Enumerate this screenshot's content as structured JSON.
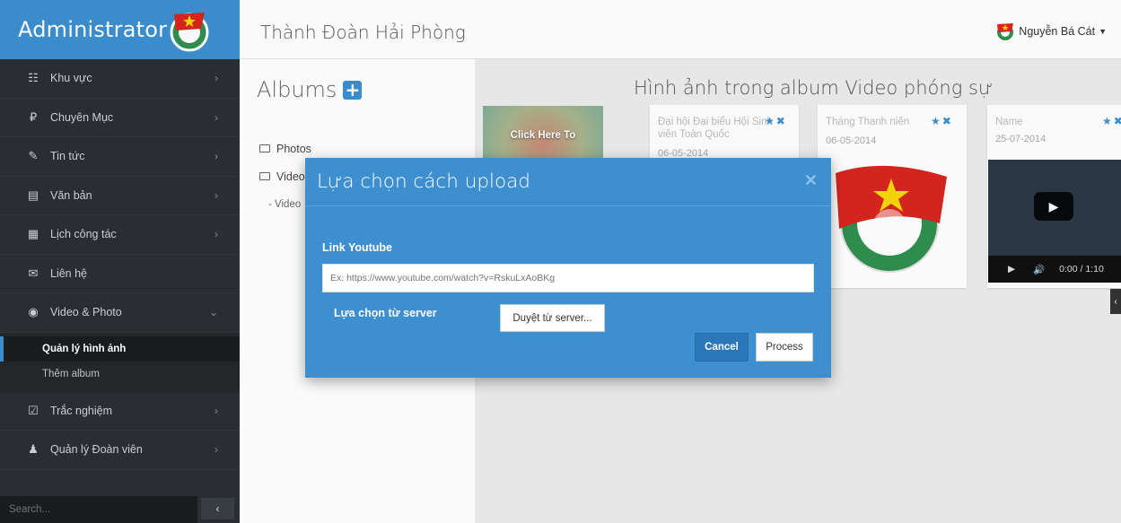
{
  "brand": {
    "title": "Administrator"
  },
  "header": {
    "site_title": "Thành Đoàn Hải Phòng",
    "user_name": "Nguyễn Bá Cát"
  },
  "sidebar": {
    "items": [
      {
        "label": "Khu vực",
        "icon": "sitemap-icon"
      },
      {
        "label": "Chuyên Mục",
        "icon": "rouble-icon"
      },
      {
        "label": "Tin tức",
        "icon": "pencil-icon"
      },
      {
        "label": "Văn bản",
        "icon": "document-icon"
      },
      {
        "label": "Lịch công tác",
        "icon": "calendar-icon"
      },
      {
        "label": "Liên hệ",
        "icon": "envelope-icon"
      },
      {
        "label": "Video & Photo",
        "icon": "camera-icon"
      },
      {
        "label": "Trắc nghiệm",
        "icon": "checkbox-icon"
      },
      {
        "label": "Quản lý Đoàn viên",
        "icon": "person-icon"
      }
    ],
    "submenu": [
      "Quản lý hình ảnh",
      "Thêm album"
    ],
    "search_placeholder": "Search..."
  },
  "albums": {
    "title": "Albums",
    "tree": [
      "Photos",
      "Video",
      "- Video"
    ]
  },
  "content": {
    "title": "Hình ảnh trong album Video phóng sự",
    "cards": [
      {
        "name": "Đại hội Đại biểu Hội Sinh viên Toàn Quốc",
        "date": "06-05-2014"
      },
      {
        "name": "Tháng Thanh niên",
        "date": "06-05-2014"
      },
      {
        "name": "Name",
        "date": "25-07-2014"
      }
    ],
    "click_thumb_text": "Click Here To",
    "video_time": "0:00 / 1:10"
  },
  "modal": {
    "title": "Lựa chọn cách upload",
    "youtube_label": "Link Youtube",
    "youtube_placeholder": "Ex: https://www.youtube.com/watch?v=RskuLxAoBKg",
    "server_label": "Lựa chọn từ server",
    "browse_label": "Duyệt từ server...",
    "cancel_label": "Cancel",
    "process_label": "Process"
  },
  "colors": {
    "primary": "#3d8fd0",
    "sidebar": "#2b2f33"
  }
}
